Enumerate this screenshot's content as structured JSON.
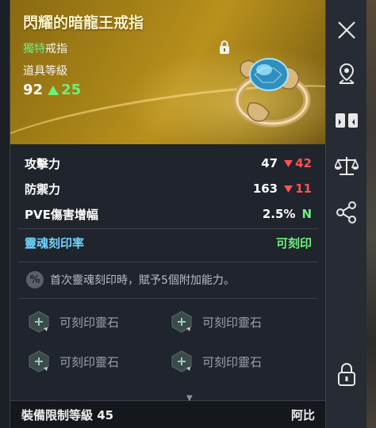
{
  "item": {
    "name": "閃耀的暗龍王戒指",
    "rarity": "獨特",
    "type": "戒指",
    "level_label": "道具等級",
    "level": "92",
    "level_up": "25"
  },
  "stats": [
    {
      "label": "攻擊力",
      "value": "47",
      "diff": "42",
      "diff_dir": "down"
    },
    {
      "label": "防禦力",
      "value": "163",
      "diff": "11",
      "diff_dir": "down"
    },
    {
      "label": "PVE傷害增幅",
      "value": "2.5%",
      "badge": "N"
    }
  ],
  "soul": {
    "label": "靈魂刻印率",
    "value": "可刻印"
  },
  "bonus_text": "首次靈魂刻印時，賦予5個附加能力。",
  "sockets": [
    "可刻印靈石",
    "可刻印靈石",
    "可刻印靈石",
    "可刻印靈石"
  ],
  "footer": {
    "requirement": "裝備限制等級 45",
    "class": "阿比"
  },
  "icons": {
    "close": "close-icon",
    "locate": "map-pin-icon",
    "compare": "compare-icon",
    "scale": "scale-icon",
    "share": "share-icon",
    "lock": "lock-icon"
  },
  "colors": {
    "rarity": "#6ef07a",
    "soul": "#6fd3ff",
    "down": "#ff5353",
    "header_gold": "#a27f16"
  }
}
